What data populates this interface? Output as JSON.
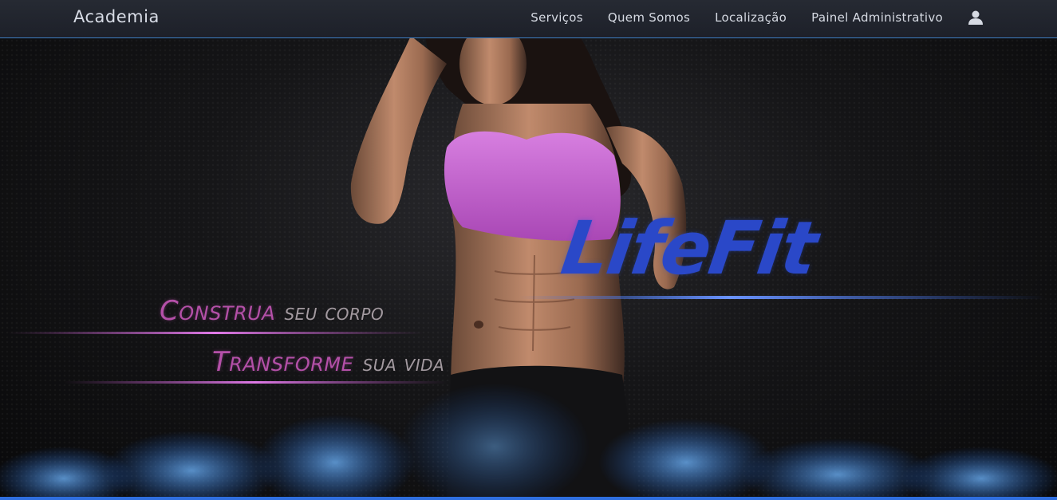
{
  "navbar": {
    "brand": "Academia",
    "links": [
      "Serviços",
      "Quem Somos",
      "Localização",
      "Painel Administrativo"
    ],
    "user_icon": "user-icon"
  },
  "hero": {
    "logo": "LifeFit",
    "tagline_1_accent": "Construa",
    "tagline_1_rest": "seu corpo",
    "tagline_2_accent": "Transforme",
    "tagline_2_rest": "sua vida"
  },
  "colors": {
    "navbar_bg": "#22262f",
    "navbar_border": "#3e7fc4",
    "logo_blue": "#2a48c8",
    "tagline_accent": "#b450a8",
    "top_purple": "#c86fd4",
    "smoke_blue": "#2f7fe0"
  }
}
